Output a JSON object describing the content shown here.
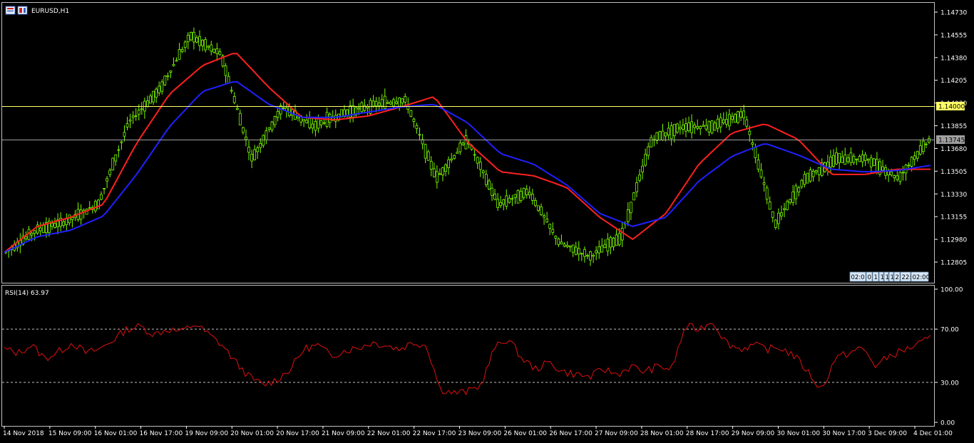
{
  "window": {
    "symbol_label": "EURUSD,H1"
  },
  "colors": {
    "background": "#000000",
    "bull_candle": "#7CFC00",
    "ma_fast": "#ff2020",
    "ma_slow": "#2020ff",
    "rsi_line": "#e01010",
    "level_line": "#ffff66",
    "bid_line": "#c0c0c0",
    "frame": "#c0c0c0"
  },
  "icons": [
    "chart-window-icon",
    "chart-window-icon-2"
  ],
  "price_panel": {
    "horizontal_line_label": "1.14000",
    "current_price_label": "1.13745",
    "scale_widget_labels": [
      "02:0",
      "0",
      "1",
      "1",
      "1",
      "1",
      "2",
      "22:",
      "02:00"
    ]
  },
  "rsi_panel": {
    "label": "RSI(14) 63.97"
  },
  "chart_data": [
    {
      "type": "line",
      "title": "EURUSD,H1",
      "xlabel": "",
      "ylabel": "",
      "ylim": [
        1.127,
        1.148
      ],
      "y_ticks": [
        "1.14730",
        "1.14555",
        "1.14380",
        "1.14205",
        "1.14030",
        "1.13855",
        "1.13680",
        "1.13505",
        "1.13330",
        "1.13155",
        "1.12980",
        "1.12805"
      ],
      "x_ticks": [
        "14 Nov 2018",
        "15 Nov 09:00",
        "16 Nov 01:00",
        "16 Nov 17:00",
        "19 Nov 09:00",
        "20 Nov 01:00",
        "20 Nov 17:00",
        "21 Nov 09:00",
        "22 Nov 01:00",
        "22 Nov 17:00",
        "23 Nov 09:00",
        "26 Nov 01:00",
        "26 Nov 17:00",
        "27 Nov 09:00",
        "28 Nov 01:00",
        "28 Nov 17:00",
        "29 Nov 09:00",
        "30 Nov 01:00",
        "30 Nov 17:00",
        "3 Dec 09:00",
        "4 Dec 01:00"
      ],
      "x": [
        0,
        1,
        2,
        3,
        4,
        5,
        6,
        7,
        8,
        9,
        10,
        11,
        12,
        13,
        14,
        15,
        16,
        17,
        18,
        19,
        20
      ],
      "series": [
        {
          "values": [
            1.1288,
            1.1305,
            1.1312,
            1.1325,
            1.1388,
            1.1413,
            1.1455,
            1.144,
            1.136,
            1.14,
            1.1385,
            1.1395,
            1.1402,
            1.1405,
            1.1345,
            1.1375,
            1.1325,
            1.1335,
            1.1295,
            1.1285,
            1.13,
            1.1375,
            1.1385,
            1.1385,
            1.1395,
            1.131,
            1.1345,
            1.136,
            1.136,
            1.1345,
            1.1375
          ]
        },
        {
          "values": [
            1.1288,
            1.1308,
            1.1315,
            1.1325,
            1.1372,
            1.141,
            1.1432,
            1.1442,
            1.1415,
            1.1392,
            1.139,
            1.1393,
            1.14,
            1.1408,
            1.1373,
            1.135,
            1.1347,
            1.1338,
            1.1315,
            1.1298,
            1.1318,
            1.1356,
            1.138,
            1.1387,
            1.1375,
            1.1348,
            1.1348,
            1.1352,
            1.1352
          ]
        },
        {
          "values": [
            1.1288,
            1.13,
            1.1305,
            1.1316,
            1.1348,
            1.1385,
            1.1412,
            1.142,
            1.1402,
            1.1392,
            1.1392,
            1.1396,
            1.14,
            1.1402,
            1.1388,
            1.1364,
            1.1356,
            1.134,
            1.1318,
            1.1308,
            1.1315,
            1.1343,
            1.1362,
            1.1372,
            1.1363,
            1.1352,
            1.135,
            1.1351,
            1.1355
          ]
        }
      ]
    },
    {
      "type": "line",
      "title": "RSI(14) 63.97",
      "xlabel": "",
      "ylabel": "",
      "ylim": [
        0,
        100
      ],
      "y_ticks": [
        "100.00",
        "70.00",
        "30.00",
        "0.00"
      ],
      "levels": [
        70,
        30
      ],
      "series": [
        {
          "values": [
            55,
            52,
            58,
            48,
            53,
            60,
            52,
            55,
            62,
            70,
            72,
            66,
            70,
            68,
            74,
            66,
            58,
            45,
            34,
            28,
            32,
            40,
            55,
            58,
            50,
            54,
            56,
            60,
            58,
            55,
            60,
            58,
            25,
            22,
            23,
            28,
            56,
            63,
            48,
            40,
            45,
            38,
            36,
            34,
            40,
            36,
            42,
            38,
            42,
            40,
            72,
            70,
            76,
            60,
            55,
            58,
            55,
            56,
            50,
            38,
            24,
            48,
            52,
            56,
            42,
            50,
            54,
            58,
            63
          ]
        }
      ]
    }
  ]
}
